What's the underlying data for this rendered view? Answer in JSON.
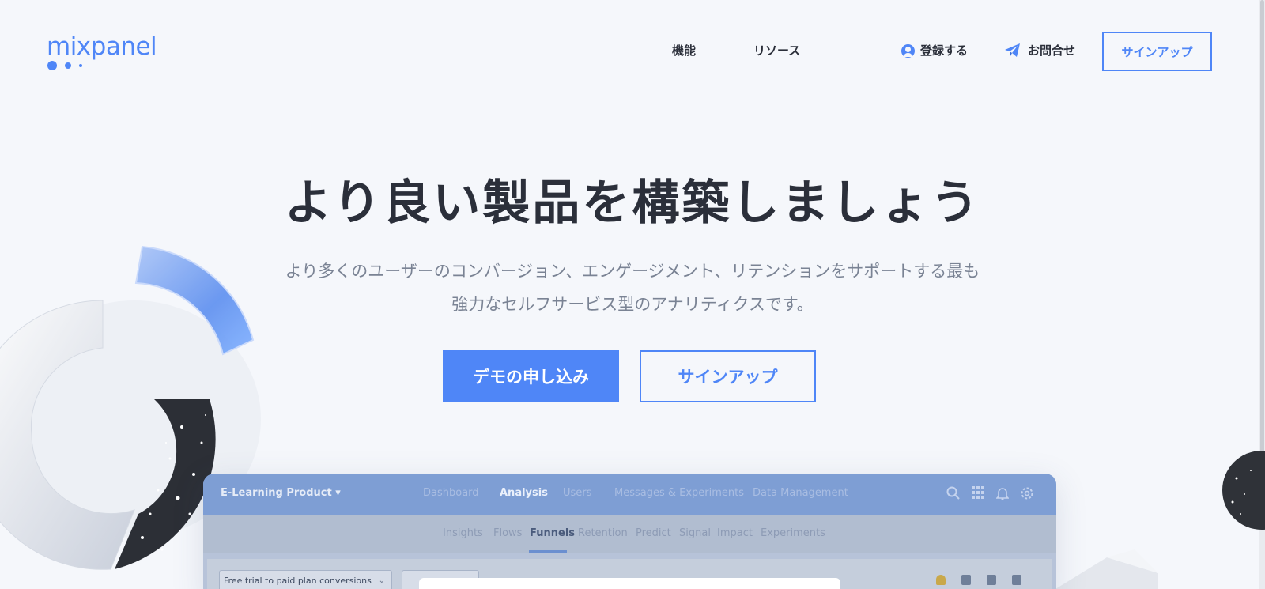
{
  "header": {
    "logo_text": "mixpanel",
    "nav": {
      "features": "機能",
      "resources": "リソース",
      "login": "登録する",
      "contact": "お問合せ",
      "signup": "サインアップ"
    }
  },
  "hero": {
    "title": "より良い製品を構築しましょう",
    "subtitle_line1": "より多くのユーザーのコンバージョン、エンゲージメント、リテンションをサポートする最も",
    "subtitle_line2": "強力なセルフサービス型のアナリティクスです。",
    "demo_button": "デモの申し込み",
    "signup_button": "サインアップ"
  },
  "preview": {
    "product_name": "E-Learning Product ▾",
    "top_nav": [
      {
        "label": "Dashboard",
        "active": false
      },
      {
        "label": "Analysis",
        "active": true
      },
      {
        "label": "Users",
        "active": false
      },
      {
        "label": "Messages & Experiments",
        "active": false
      },
      {
        "label": "Data Management",
        "active": false
      }
    ],
    "tabs": [
      {
        "label": "Insights",
        "active": false
      },
      {
        "label": "Flows",
        "active": false
      },
      {
        "label": "Funnels",
        "active": true
      },
      {
        "label": "Retention",
        "active": false
      },
      {
        "label": "Predict",
        "active": false
      },
      {
        "label": "Signal",
        "active": false
      },
      {
        "label": "Impact",
        "active": false
      },
      {
        "label": "Experiments",
        "active": false
      }
    ],
    "report_select": "Free trial to paid plan conversions"
  },
  "colors": {
    "accent": "#4f86f7",
    "text": "#2b2f3a",
    "muted": "#7a8394",
    "background": "#f5f7fb"
  }
}
